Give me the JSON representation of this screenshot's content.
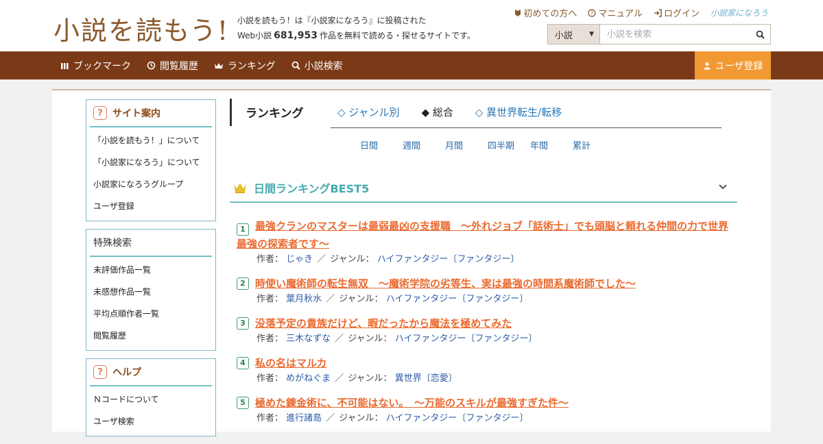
{
  "header": {
    "logo": "小説を読もう!",
    "tagline_line1": "小説を読もう！は『小説家になろう』に投稿された",
    "tagline_prefix": "Web小説",
    "work_count": "681,953",
    "tagline_suffix": "作品を無料で読める・探せるサイトです。",
    "links": [
      {
        "label": "初めての方へ",
        "icon": "beginner-icon"
      },
      {
        "label": "マニュアル",
        "icon": "help-icon"
      },
      {
        "label": "ログイン",
        "icon": "login-icon"
      }
    ],
    "narou_logo": "小説家になろう",
    "search": {
      "select_value": "小説",
      "placeholder": "小説を検索"
    }
  },
  "nav": {
    "items": [
      {
        "label": "ブックマーク",
        "icon": "bookmark-icon"
      },
      {
        "label": "閲覧履歴",
        "icon": "history-icon"
      },
      {
        "label": "ランキング",
        "icon": "crown-icon"
      },
      {
        "label": "小説検索",
        "icon": "search-icon"
      }
    ],
    "register": "ユーザ登録"
  },
  "sidebar": {
    "site_guide": {
      "title": "サイト案内",
      "links": [
        "「小説を読もう！」について",
        "「小説家になろう」について",
        "小説家になろうグループ",
        "ユーザ登録"
      ]
    },
    "special_search": {
      "title": "特殊検索",
      "links": [
        "未評価作品一覧",
        "未感想作品一覧",
        "平均点順作者一覧",
        "閲覧履歴"
      ]
    },
    "help": {
      "title": "ヘルプ",
      "links": [
        "Ｎコードについて",
        "ユーザ検索"
      ]
    }
  },
  "ranking": {
    "heading": "ランキング",
    "tabs": [
      "◇ ジャンル別",
      "◆ 総合",
      "◇ 異世界転生/転移"
    ],
    "active_tab": "◆ 総合",
    "periods": [
      "日間",
      "週間",
      "月間",
      "四半期",
      "年間",
      "累計"
    ],
    "best_title": "日間ランキングBEST5",
    "author_label": "作者：",
    "genre_label": "ジャンル：",
    "items": [
      {
        "rank": "1",
        "title": "最強クランのマスターは最弱最凶の支援職　～外れジョブ「話術士」でも頭脳と頼れる仲間の力で世界最強の探索者です～",
        "author": "じゃき",
        "genre": "ハイファンタジー〔ファンタジー〕"
      },
      {
        "rank": "2",
        "title": "時使い魔術師の転生無双　～魔術学院の劣等生、実は最強の時間系魔術師でした～",
        "author": "葉月秋水",
        "genre": "ハイファンタジー〔ファンタジー〕"
      },
      {
        "rank": "3",
        "title": "没落予定の貴族だけど、暇だったから魔法を極めてみた",
        "author": "三木なずな",
        "genre": "ハイファンタジー〔ファンタジー〕"
      },
      {
        "rank": "4",
        "title": "私の名はマルカ",
        "author": "めがねぐま",
        "genre": "異世界〔恋愛〕"
      },
      {
        "rank": "5",
        "title": "極めた錬金術に、不可能はない。　～万能のスキルが最強すぎた件～",
        "author": "進行諸島",
        "genre": "ハイファンタジー〔ファンタジー〕"
      }
    ]
  },
  "colors": {
    "brand_brown": "#7b3a17",
    "register_orange": "#f39933",
    "title_orange": "#ea6a30",
    "teal": "#44aab0",
    "link_blue": "#2a6aa8"
  }
}
